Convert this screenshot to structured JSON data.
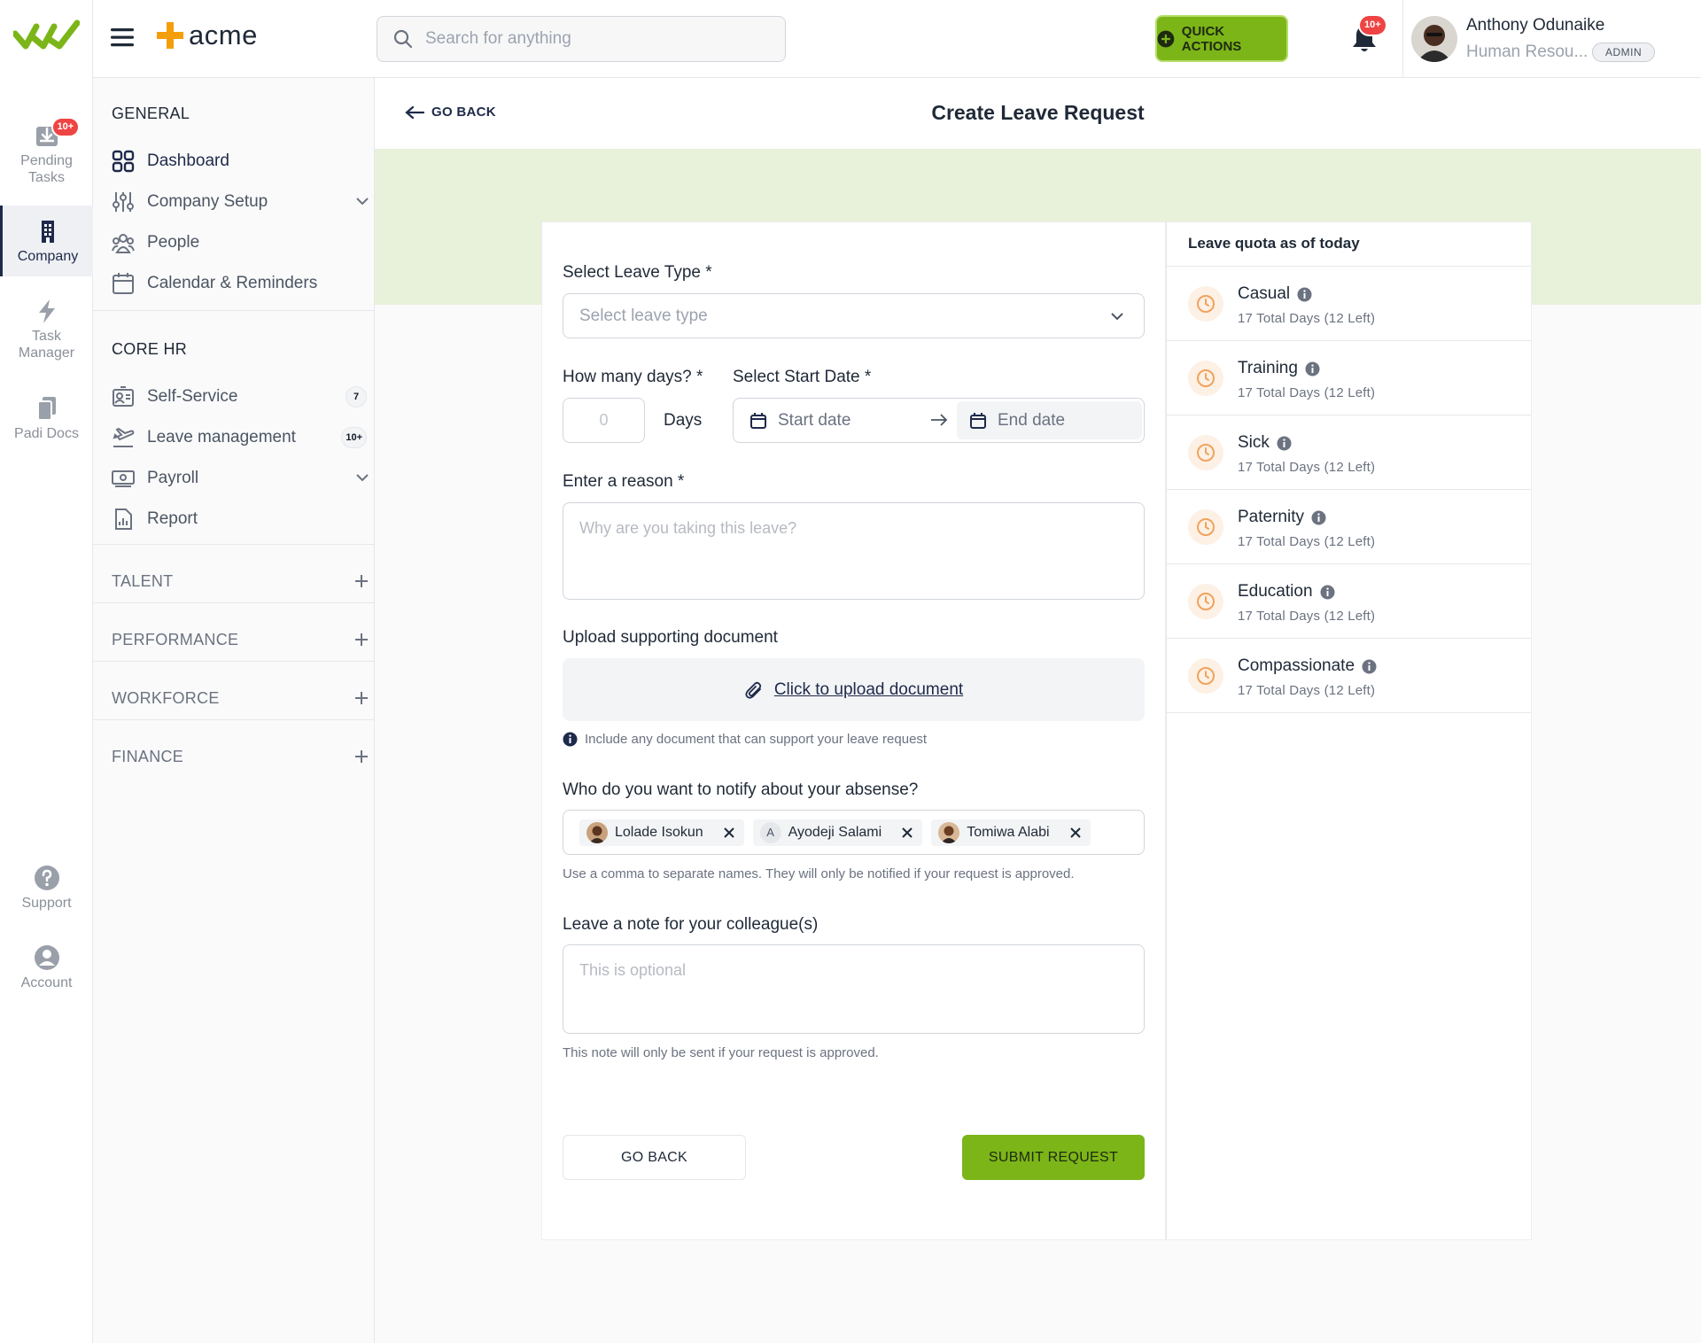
{
  "rail": {
    "items": [
      {
        "label_1": "Pending",
        "label_2": "Tasks",
        "badge": "10+",
        "icon": "inbox-download-icon"
      },
      {
        "label_1": "Company",
        "label_2": "",
        "icon": "building-icon"
      },
      {
        "label_1": "Task",
        "label_2": "Manager",
        "icon": "lightning-icon"
      },
      {
        "label_1": "Padi Docs",
        "label_2": "",
        "icon": "documents-icon"
      },
      {
        "label_1": "Support",
        "label_2": "",
        "icon": "help-icon"
      },
      {
        "label_1": "Account",
        "label_2": "",
        "icon": "account-icon"
      }
    ]
  },
  "header": {
    "brand": "acme",
    "search_placeholder": "Search for anything",
    "quick_actions": "QUICK ACTIONS",
    "notifications_badge": "10+",
    "user_name": "Anthony Odunaike",
    "user_role": "Human Resou...",
    "user_badge": "ADMIN"
  },
  "sidebar": {
    "general_heading": "GENERAL",
    "general": [
      {
        "label": "Dashboard",
        "icon": "grid-icon"
      },
      {
        "label": "Company Setup",
        "icon": "sliders-icon"
      },
      {
        "label": "People",
        "icon": "people-icon"
      },
      {
        "label": "Calendar & Reminders",
        "icon": "calendar-icon"
      }
    ],
    "corehr_heading": "CORE HR",
    "corehr": [
      {
        "label": "Self-Service",
        "icon": "id-card-icon",
        "count": "7"
      },
      {
        "label": "Leave management",
        "icon": "plane-icon",
        "count": "10+"
      },
      {
        "label": "Payroll",
        "icon": "money-icon"
      },
      {
        "label": "Report",
        "icon": "report-icon"
      }
    ],
    "groups": [
      "TALENT",
      "PERFORMANCE",
      "WORKFORCE",
      "FINANCE"
    ]
  },
  "page": {
    "go_back": "GO BACK",
    "title": "Create Leave Request"
  },
  "form": {
    "leave_type_label": "Select Leave Type *",
    "leave_type_placeholder": "Select leave type",
    "days_label": "How many days? *",
    "days_placeholder": "0",
    "days_unit": "Days",
    "start_date_label": "Select Start Date *",
    "start_placeholder": "Start date",
    "end_placeholder": "End date",
    "reason_label": "Enter a reason *",
    "reason_placeholder": "Why are you taking this leave?",
    "upload_label": "Upload supporting document",
    "upload_link": "Click to upload document",
    "upload_hint": "Include any document that can support your leave request",
    "notify_label": "Who do you want to notify about your absense?",
    "notify_tags": [
      {
        "name": "Lolade Isokun",
        "avatar": "photo"
      },
      {
        "name": "Ayodeji Salami",
        "avatar": "A"
      },
      {
        "name": "Tomiwa Alabi",
        "avatar": "photo"
      }
    ],
    "notify_hint": "Use a comma to separate names. They will only be notified if your request is approved.",
    "note_label": "Leave a note for your colleague(s)",
    "note_placeholder": "This is optional",
    "note_hint": "This note will only be sent if your request is approved.",
    "back_button": "GO BACK",
    "submit_button": "SUBMIT REQUEST"
  },
  "quota": {
    "heading": "Leave quota as of today",
    "items": [
      {
        "name": "Casual",
        "detail": "17 Total Days (12 Left)"
      },
      {
        "name": "Training",
        "detail": "17 Total Days (12 Left)"
      },
      {
        "name": "Sick",
        "detail": "17 Total Days (12 Left)"
      },
      {
        "name": "Paternity",
        "detail": "17 Total Days (12 Left)"
      },
      {
        "name": "Education",
        "detail": "17 Total Days (12 Left)"
      },
      {
        "name": "Compassionate",
        "detail": "17 Total Days (12 Left)"
      }
    ]
  },
  "colors": {
    "brand_green": "#7cb518",
    "navy": "#1e2a4a",
    "band": "#e8f1d9",
    "badge_red": "#ef4444",
    "quota_orange": "#f0a35e"
  }
}
